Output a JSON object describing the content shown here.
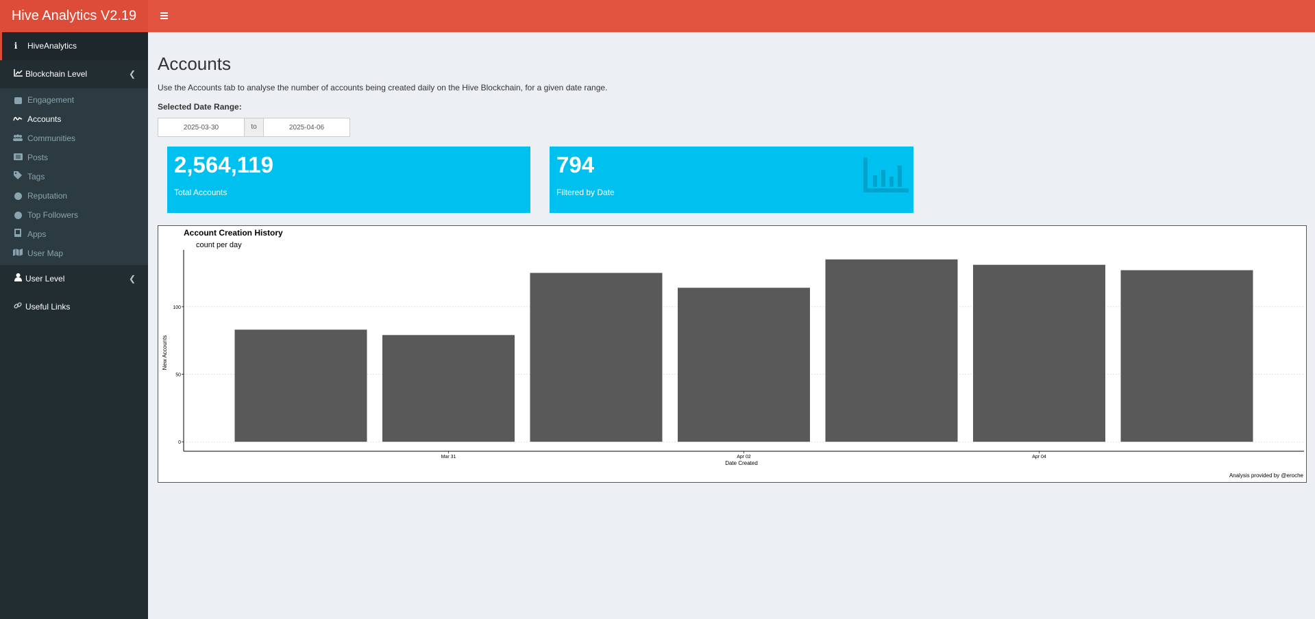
{
  "app": {
    "title": "Hive Analytics V2.19"
  },
  "sidebar": {
    "top_item": "HiveAnalytics",
    "blockchain_level": "Blockchain Level",
    "sub_items": [
      {
        "label": "Engagement",
        "icon": "thumbs-up-icon"
      },
      {
        "label": "Accounts",
        "icon": "signature-icon"
      },
      {
        "label": "Communities",
        "icon": "users-icon"
      },
      {
        "label": "Posts",
        "icon": "list-icon"
      },
      {
        "label": "Tags",
        "icon": "tag-icon"
      },
      {
        "label": "Reputation",
        "icon": "check-circle-icon"
      },
      {
        "label": "Top Followers",
        "icon": "check-circle-icon"
      },
      {
        "label": "Apps",
        "icon": "book-icon"
      },
      {
        "label": "User Map",
        "icon": "map-icon"
      }
    ],
    "user_level": "User Level",
    "useful_links": "Useful Links"
  },
  "page": {
    "title": "Accounts",
    "description": "Use the Accounts tab to analyse the number of accounts being created daily on the Hive Blockchain, for a given date range.",
    "date_range_label": "Selected Date Range:",
    "date_start": "2025-03-30",
    "date_to": "to",
    "date_end": "2025-04-06"
  },
  "value_boxes": [
    {
      "value": "2,564,119",
      "caption": "Total Accounts"
    },
    {
      "value": "794",
      "caption": "Filtered by Date"
    }
  ],
  "colors": {
    "header": "#dd4b39",
    "sidebar": "#222d32",
    "value_box": "#00c0ef",
    "bar": "#595959"
  },
  "chart_data": {
    "type": "bar",
    "title": "Account Creation History",
    "subtitle": "count per day",
    "xlabel": "Date Created",
    "ylabel": "New Accounts",
    "x": [
      "2025-03-30",
      "2025-03-31",
      "2025-04-01",
      "2025-04-02",
      "2025-04-03",
      "2025-04-04",
      "2025-04-05"
    ],
    "values": [
      83,
      79,
      125,
      114,
      135,
      131,
      127
    ],
    "x_ticks": [
      {
        "date": "2025-03-31",
        "label": "Mar 31"
      },
      {
        "date": "2025-04-02",
        "label": "Apr 02"
      },
      {
        "date": "2025-04-04",
        "label": "Apr 04"
      }
    ],
    "y_ticks": [
      0,
      50,
      100
    ],
    "ylim": [
      -7,
      142
    ],
    "grid": true,
    "caption": "Analysis provided by @eroche"
  }
}
